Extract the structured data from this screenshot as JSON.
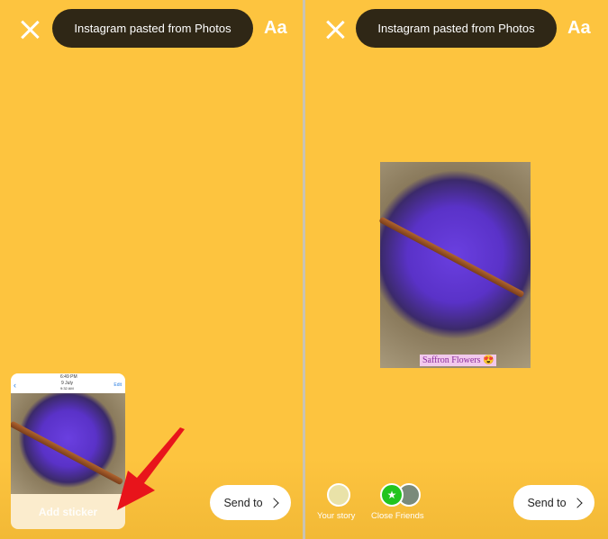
{
  "left": {
    "title": "Instagram pasted from Photos",
    "text_tool": "Aa",
    "send_label": "Send to",
    "sticker": {
      "status_time": "6:49 PM",
      "date": "9 July",
      "time": "9:32 AM",
      "edit": "Edit",
      "add_label": "Add sticker"
    }
  },
  "right": {
    "title": "Instagram pasted from Photos",
    "text_tool": "Aa",
    "send_label": "Send to",
    "caption": "Saffron Flowers 😍",
    "your_story": "Your story",
    "close_friends": "Close Friends"
  },
  "colors": {
    "background": "#fdc43f",
    "pill": "#2f2716",
    "arrow": "#e8141b",
    "close_friends": "#22c41e"
  }
}
